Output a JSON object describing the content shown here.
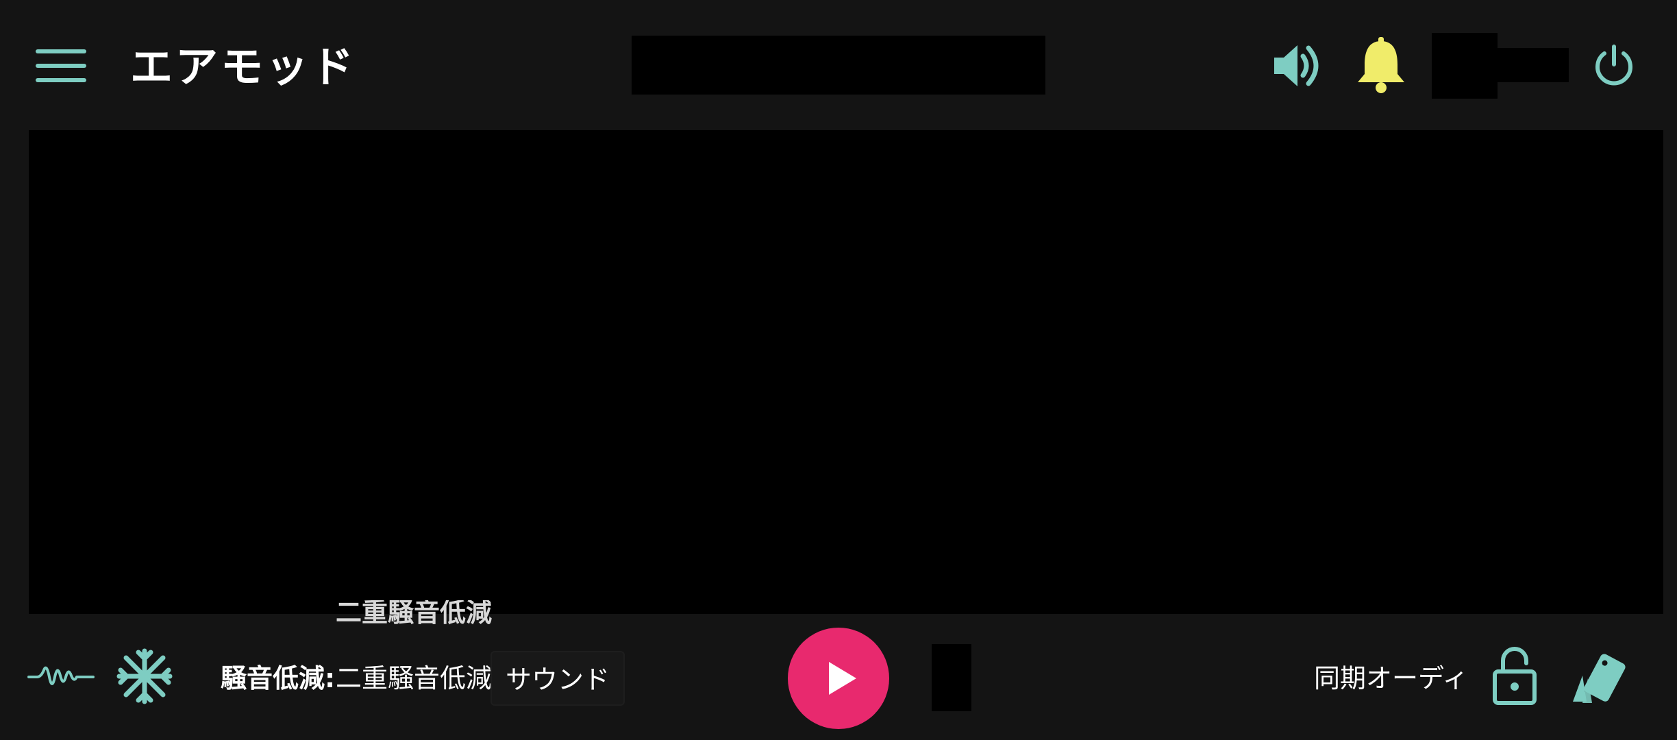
{
  "app": {
    "title": "エアモッド"
  },
  "header": {
    "menu_icon": "hamburger-menu-icon",
    "volume_icon": "speaker-volume-icon",
    "notification_icon": "bell-icon",
    "power_icon": "power-icon"
  },
  "main": {
    "partial_text": "二重騒音低減"
  },
  "footer": {
    "wave_icon": "sound-wave-icon",
    "snow_icon": "snowflake-icon",
    "noise_reduction_label": "騒音低減:",
    "noise_reduction_value": "二重騒音低減",
    "sound_tab_label": "サウンド",
    "play_icon": "play-icon",
    "sync_label": "同期オーディ",
    "lock_icon": "unlocked-padlock-icon",
    "cards_icon": "cards-icon"
  },
  "colors": {
    "background": "#141414",
    "accent_teal": "#7ecdc2",
    "bell_yellow": "#f0ec6a",
    "play_pink": "#e8296e",
    "masked": "#000000"
  }
}
